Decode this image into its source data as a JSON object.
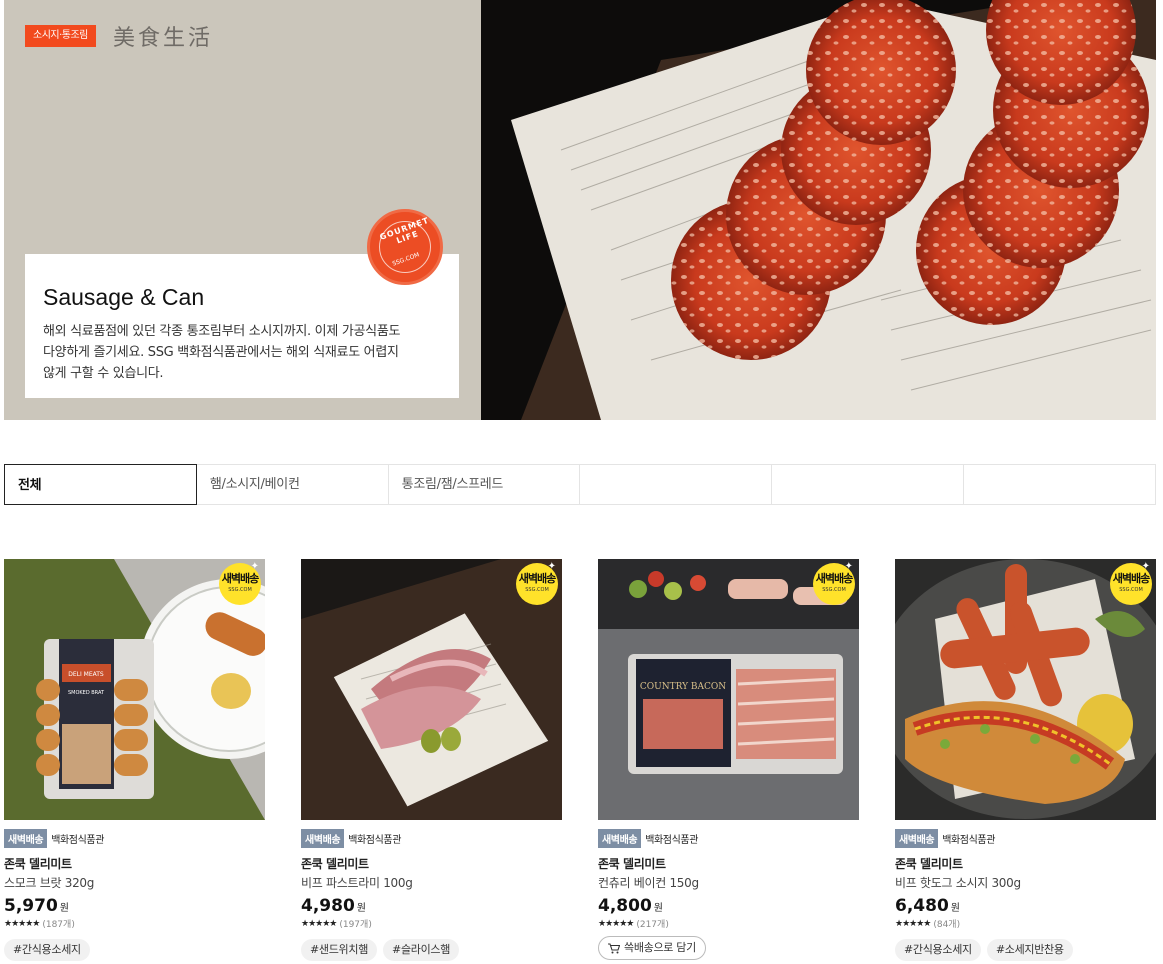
{
  "hero": {
    "tag": "소시지·통조림",
    "brand": "美食生活",
    "title": "Sausage & Can",
    "description": "해외 식료품점에 있던 각종 통조림부터 소시지까지. 이제 가공식품도 다양하게 즐기세요. SSG 백화점식품관에서는 해외 식재료도 어렵지 않게 구할 수 있습니다.",
    "seal_text": "GOURMET LIFE",
    "seal_sub": "SSG.COM"
  },
  "tabs": [
    {
      "label": "전체",
      "active": true
    },
    {
      "label": "햄/소시지/베이컨",
      "active": false
    },
    {
      "label": "통조림/잼/스프레드",
      "active": false
    },
    {
      "label": "",
      "active": false
    },
    {
      "label": "",
      "active": false
    },
    {
      "label": "",
      "active": false
    }
  ],
  "badge": {
    "line1": "새벽배송",
    "line2": "SSG.COM"
  },
  "products": [
    {
      "delivery": "새벽배송",
      "store": "백화점식품관",
      "brand": "존쿡 델리미트",
      "name": "스모크 브랏 320g",
      "price": "5,970",
      "currency": "원",
      "stars": "★★★★★",
      "reviews": "(187개)",
      "tags": [
        "#간식용소세지"
      ]
    },
    {
      "delivery": "새벽배송",
      "store": "백화점식품관",
      "brand": "존쿡 델리미트",
      "name": "비프 파스트라미 100g",
      "price": "4,980",
      "currency": "원",
      "stars": "★★★★★",
      "reviews": "(197개)",
      "tags": [
        "#샌드위치햄",
        "#슬라이스햄"
      ]
    },
    {
      "delivery": "새벽배송",
      "store": "백화점식품관",
      "brand": "존쿡 델리미트",
      "name": "컨츄리 베이컨 150g",
      "price": "4,800",
      "currency": "원",
      "stars": "★★★★★",
      "reviews": "(217개)",
      "cart_label": "쓱배송으로 담기",
      "tags": []
    },
    {
      "delivery": "새벽배송",
      "store": "백화점식품관",
      "brand": "존쿡 델리미트",
      "name": "비프 핫도그 소시지 300g",
      "price": "6,480",
      "currency": "원",
      "stars": "★★★★★",
      "reviews": "(84개)",
      "tags": [
        "#간식용소세지",
        "#소세지반찬용"
      ]
    }
  ],
  "product_images": [
    {
      "label_text": "DELI MEATS",
      "label_sub": "SMOKED BRAT"
    },
    {},
    {
      "label_text": "COUNTRY BACON"
    },
    {}
  ]
}
